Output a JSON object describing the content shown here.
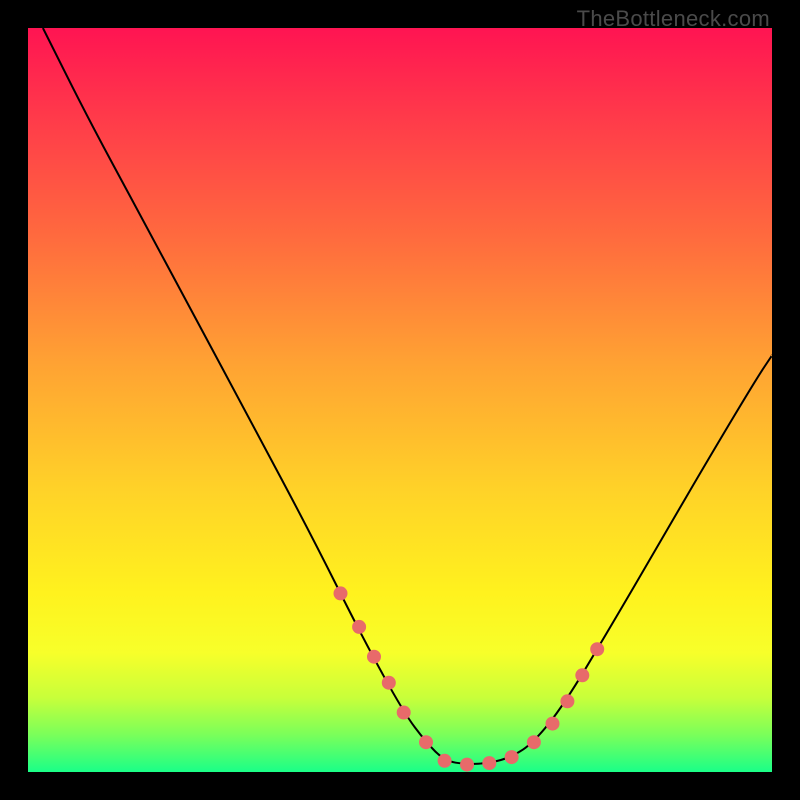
{
  "watermark": "TheBottleneck.com",
  "chart_data": {
    "type": "line",
    "title": "",
    "xlabel": "",
    "ylabel": "",
    "xlim": [
      0,
      100
    ],
    "ylim": [
      0,
      100
    ],
    "series": [
      {
        "name": "bottleneck-curve",
        "x": [
          2,
          8,
          15,
          22,
          30,
          38,
          45,
          50.5,
          53.5,
          56,
          59,
          62,
          65,
          68,
          72,
          78,
          85,
          92,
          98,
          100
        ],
        "y": [
          100,
          88,
          75,
          62,
          47,
          32,
          18,
          8,
          4,
          1.5,
          1,
          1.2,
          2,
          4,
          9,
          19,
          31,
          43,
          53,
          56
        ]
      }
    ],
    "scatter_points": {
      "name": "highlighted-dots",
      "x": [
        42,
        44.5,
        46.5,
        48.5,
        50.5,
        53.5,
        56,
        59,
        62,
        65,
        68,
        70.5,
        72.5,
        74.5,
        76.5
      ],
      "y": [
        24,
        19.5,
        15.5,
        12,
        8,
        4,
        1.5,
        1,
        1.2,
        2,
        4,
        6.5,
        9.5,
        13,
        16.5
      ]
    },
    "colors": {
      "curve": "#000000",
      "dots": "#e86a6a",
      "gradient_top": "#ff1452",
      "gradient_mid": "#ffd228",
      "gradient_bottom": "#1aff88"
    }
  }
}
